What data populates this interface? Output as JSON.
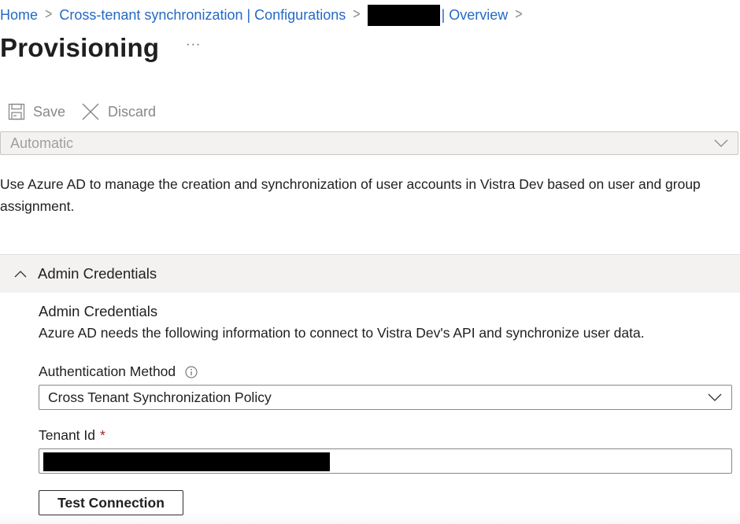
{
  "breadcrumb": {
    "items": [
      "Home",
      "Cross-tenant synchronization | Configurations",
      "| Overview"
    ],
    "separator_icon": "chevron-right-icon",
    "redacted_segment": true
  },
  "header": {
    "title": "Provisioning",
    "more_label": "···"
  },
  "toolbar": {
    "save_label": "Save",
    "save_icon": "save-icon",
    "discard_label": "Discard",
    "discard_icon": "close-icon"
  },
  "provisioning_mode": {
    "value": "Automatic",
    "disabled": true
  },
  "description": "Use Azure AD to manage the creation and synchronization of user accounts in Vistra Dev based on user and group assignment.",
  "admin_credentials": {
    "section_label": "Admin Credentials",
    "expanded": true,
    "subtitle": "Admin Credentials",
    "subdescription": "Azure AD needs the following information to connect to Vistra Dev's API and synchronize user data.",
    "auth_method": {
      "label": "Authentication Method",
      "value": "Cross Tenant Synchronization Policy"
    },
    "tenant_id": {
      "label": "Tenant Id",
      "required_marker": "*",
      "value_redacted": true
    },
    "test_connection_label": "Test Connection"
  },
  "colors": {
    "link": "#2469c5",
    "required": "#a4262c",
    "section_bg": "#f3f2f1"
  }
}
